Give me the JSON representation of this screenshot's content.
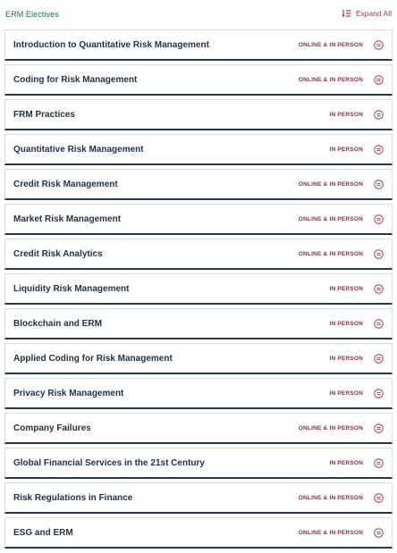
{
  "header": {
    "title": "ERM Electives",
    "expand_all_label": "Expand All",
    "expand_icon": "expand-list-icon"
  },
  "colors": {
    "title_green": "#1f6b5c",
    "accent_red": "#b0324b",
    "badge_purple": "#8a2b55",
    "navy_text": "#1e3146",
    "navy_border": "#23384c"
  },
  "courses": [
    {
      "title": "Introduction to Quantitative Risk Management",
      "delivery": "ONLINE & IN PERSON"
    },
    {
      "title": "Coding for Risk Management",
      "delivery": "ONLINE & IN PERSON"
    },
    {
      "title": "FRM Practices",
      "delivery": "IN PERSON"
    },
    {
      "title": "Quantitative Risk Management",
      "delivery": "IN PERSON"
    },
    {
      "title": "Credit Risk Management",
      "delivery": "ONLINE & IN PERSON"
    },
    {
      "title": "Market Risk Management",
      "delivery": "ONLINE & IN PERSON"
    },
    {
      "title": "Credit Risk Analytics",
      "delivery": "ONLINE & IN PERSON"
    },
    {
      "title": "Liquidity Risk Management",
      "delivery": "IN PERSON"
    },
    {
      "title": "Blockchain and ERM",
      "delivery": "IN PERSON"
    },
    {
      "title": "Applied Coding for Risk Management",
      "delivery": "IN PERSON"
    },
    {
      "title": "Privacy Risk Management",
      "delivery": "IN PERSON"
    },
    {
      "title": "Company Failures",
      "delivery": "ONLINE & IN PERSON"
    },
    {
      "title": "Global Financial Services in the 21st Century",
      "delivery": "IN PERSON"
    },
    {
      "title": "Risk Regulations in Finance",
      "delivery": "ONLINE & IN PERSON"
    },
    {
      "title": "ESG and ERM",
      "delivery": "ONLINE & IN PERSON"
    }
  ]
}
